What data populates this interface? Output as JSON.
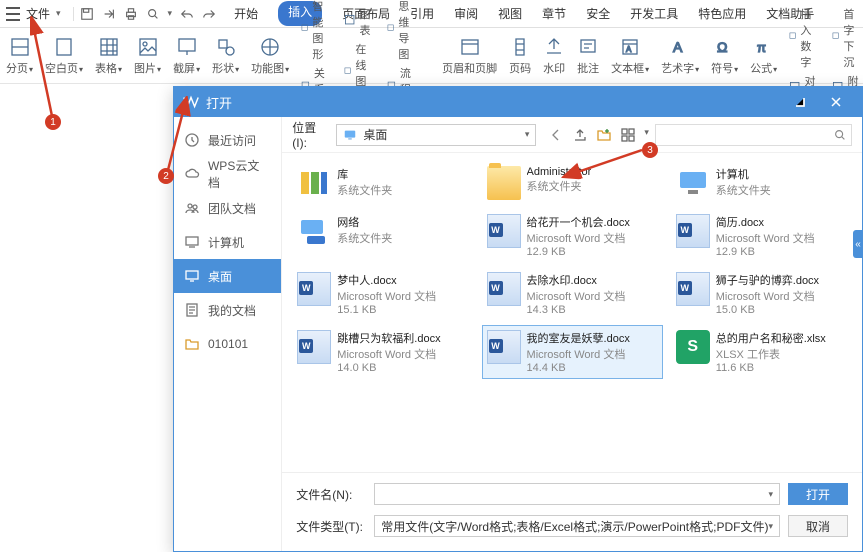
{
  "menubar": {
    "file": "文件",
    "tabs": [
      "开始",
      "插入",
      "页面布局",
      "引用",
      "审阅",
      "视图",
      "章节",
      "安全",
      "开发工具",
      "特色应用",
      "文档助手"
    ],
    "active_tab": 1
  },
  "ribbon": {
    "items": [
      {
        "label": "分页"
      },
      {
        "label": "空白页"
      },
      {
        "label": "表格"
      },
      {
        "label": "图片"
      },
      {
        "label": "截屏"
      },
      {
        "label": "形状"
      },
      {
        "label": "功能图"
      }
    ],
    "sub1": [
      {
        "label": "智能图形"
      },
      {
        "label": "关系图"
      }
    ],
    "sub2": [
      {
        "label": "图表"
      },
      {
        "label": "在线图表"
      }
    ],
    "sub3": [
      {
        "label": "思维导图"
      },
      {
        "label": "流程图"
      }
    ],
    "items2": [
      {
        "label": "页眉和页脚"
      },
      {
        "label": "页码"
      },
      {
        "label": "水印"
      },
      {
        "label": "批注"
      },
      {
        "label": "文本框"
      },
      {
        "label": "艺术字"
      },
      {
        "label": "符号"
      },
      {
        "label": "公式"
      }
    ],
    "items3": [
      {
        "label": "插入数字"
      },
      {
        "label": "对象"
      }
    ],
    "sub4": [
      {
        "label": "首字下沉"
      },
      {
        "label": "附件"
      }
    ]
  },
  "dialog": {
    "title": "打开",
    "loc_label": "位置(I):",
    "loc_value": "桌面",
    "sidenav": [
      {
        "label": "最近访问",
        "icon": "clock"
      },
      {
        "label": "WPS云文档",
        "icon": "cloud"
      },
      {
        "label": "团队文档",
        "icon": "team"
      },
      {
        "label": "计算机",
        "icon": "computer"
      },
      {
        "label": "桌面",
        "icon": "desktop",
        "active": true
      },
      {
        "label": "我的文档",
        "icon": "docs"
      },
      {
        "label": "010101",
        "icon": "folder"
      }
    ],
    "files": [
      {
        "name": "库",
        "desc": "系统文件夹",
        "type": "lib"
      },
      {
        "name": "Administrator",
        "desc": "系统文件夹",
        "type": "folder"
      },
      {
        "name": "计算机",
        "desc": "系统文件夹",
        "type": "pc"
      },
      {
        "name": "网络",
        "desc": "系统文件夹",
        "type": "net"
      },
      {
        "name": "给花开一个机会.docx",
        "desc": "Microsoft Word 文档",
        "size": "12.9 KB",
        "type": "word"
      },
      {
        "name": "简历.docx",
        "desc": "Microsoft Word 文档",
        "size": "12.9 KB",
        "type": "word"
      },
      {
        "name": "梦中人.docx",
        "desc": "Microsoft Word 文档",
        "size": "15.1 KB",
        "type": "word"
      },
      {
        "name": "去除水印.docx",
        "desc": "Microsoft Word 文档",
        "size": "14.3 KB",
        "type": "word"
      },
      {
        "name": "狮子与驴的博弈.docx",
        "desc": "Microsoft Word 文档",
        "size": "15.0 KB",
        "type": "word"
      },
      {
        "name": "跳槽只为软福利.docx",
        "desc": "Microsoft Word 文档",
        "size": "14.0 KB",
        "type": "word"
      },
      {
        "name": "我的室友是妖孽.docx",
        "desc": "Microsoft Word 文档",
        "size": "14.4 KB",
        "type": "word",
        "selected": true
      },
      {
        "name": "总的用户名和秘密.xlsx",
        "desc": "XLSX 工作表",
        "size": "11.6 KB",
        "type": "xlsx"
      }
    ],
    "filename_label": "文件名(N):",
    "filename_value": "",
    "filetype_label": "文件类型(T):",
    "filetype_value": "常用文件(文字/Word格式;表格/Excel格式;演示/PowerPoint格式;PDF文件)",
    "btn_open": "打开",
    "btn_cancel": "取消"
  },
  "badges": [
    "1",
    "2",
    "3"
  ]
}
